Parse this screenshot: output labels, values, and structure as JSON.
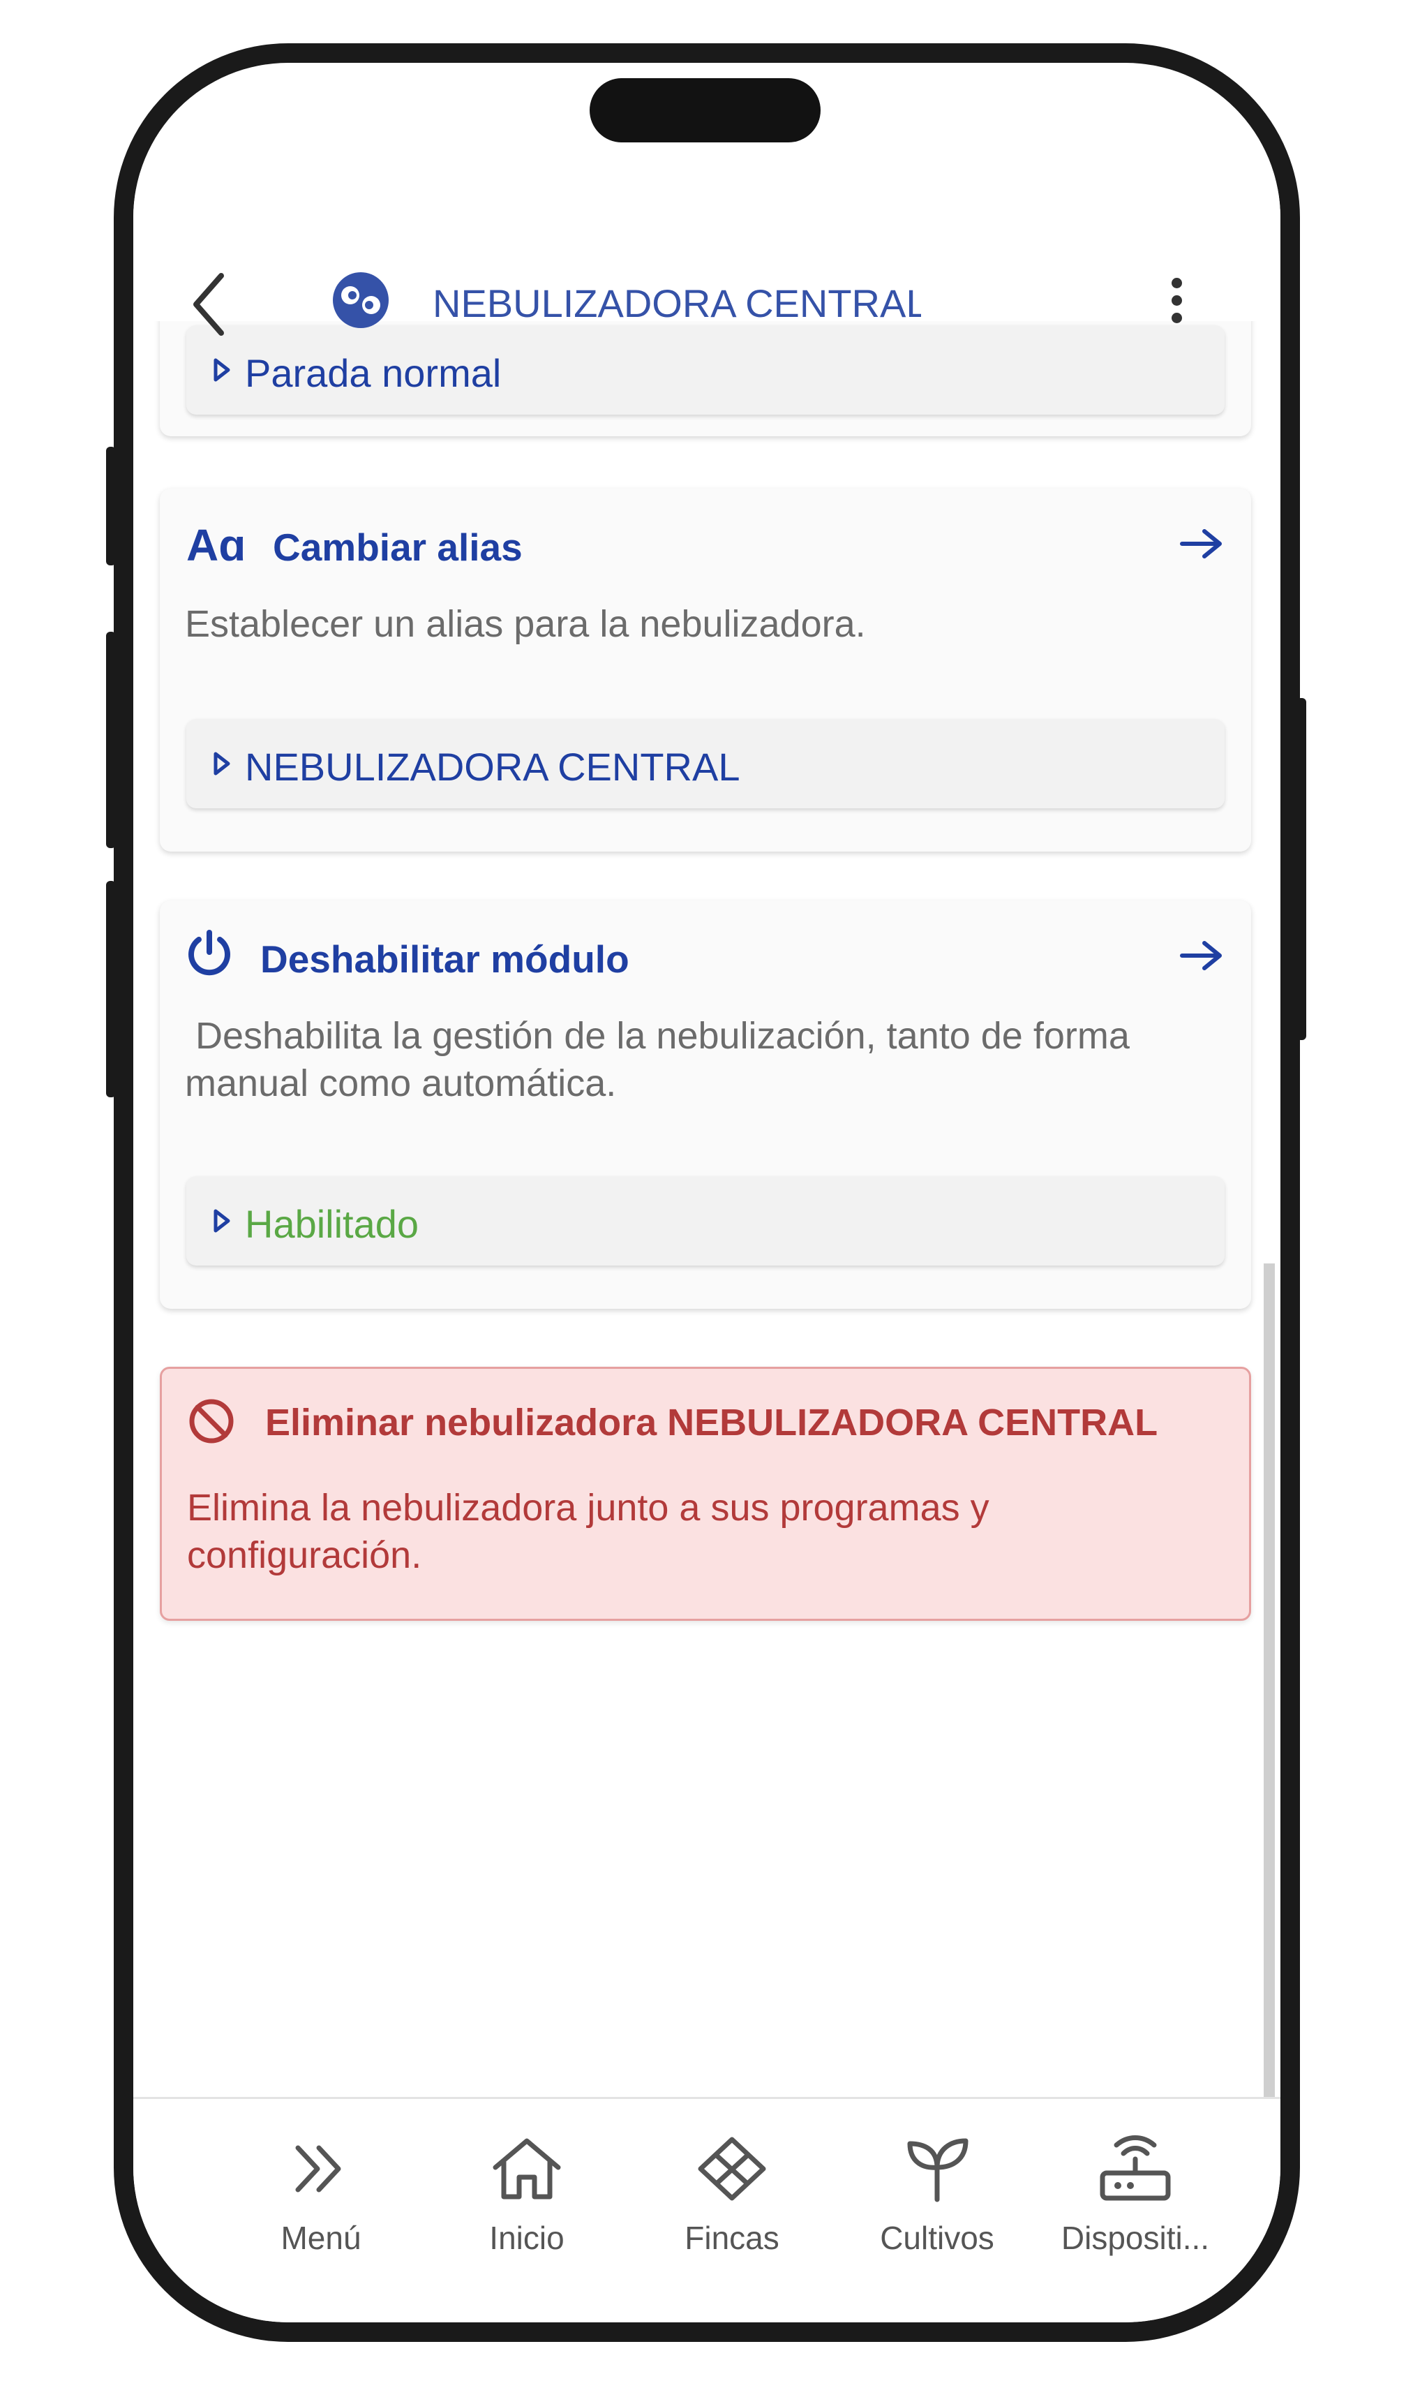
{
  "header": {
    "title": "NEBULIZADORA CENTRAL - Connec..."
  },
  "cards": {
    "parada": {
      "value": "Parada normal"
    },
    "alias": {
      "title": "Cambiar alias",
      "icon_text": "Aɑ",
      "description": "Establecer un alias para la nebulizadora.",
      "value": "NEBULIZADORA CENTRAL"
    },
    "modulo": {
      "title": "Deshabilitar módulo",
      "description": " Deshabilita la gestión de la nebulización, tanto de forma manual como automática.",
      "value": "Habilitado"
    },
    "eliminar": {
      "title": "Eliminar nebulizadora NEBULIZADORA CENTRAL",
      "description": "Elimina la nebulizadora junto a sus programas y configuración."
    }
  },
  "nav": {
    "items": [
      {
        "label": "Menú"
      },
      {
        "label": "Inicio"
      },
      {
        "label": "Fincas"
      },
      {
        "label": "Cultivos"
      },
      {
        "label": "Dispositi..."
      }
    ]
  },
  "colors": {
    "accent": "#1f3fa2",
    "title_blue": "#3552a8",
    "success": "#5aa845",
    "danger_text": "#b23a3a",
    "danger_bg": "#fbe1e1"
  },
  "icons": [
    "back-icon",
    "logo-icon",
    "kebab-icon",
    "triangle-icon",
    "font-icon",
    "arrow-right-icon",
    "power-icon",
    "block-icon",
    "double-chevron-icon",
    "home-icon",
    "fields-icon",
    "plant-icon",
    "router-icon"
  ]
}
